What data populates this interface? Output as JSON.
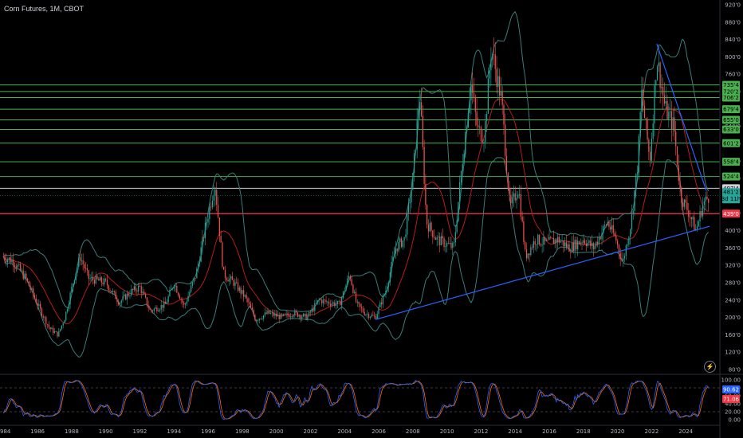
{
  "header": {
    "title": "Corn Futures, 1M, CBOT"
  },
  "icons": {
    "bolt": "lightning-icon"
  },
  "chart_data": {
    "type": "candlestick",
    "title": "Corn Futures, 1M, CBOT",
    "x_ticks": [
      "984",
      "1986",
      "1988",
      "1990",
      "1992",
      "1994",
      "1996",
      "1998",
      "2000",
      "2002",
      "2004",
      "2006",
      "2008",
      "2010",
      "2012",
      "2014",
      "2016",
      "2018",
      "2020",
      "2022",
      "2024"
    ],
    "price_ticks": [
      "920'0",
      "880'0",
      "840'0",
      "800'0",
      "760'0",
      "720'0",
      "680'0",
      "640'0",
      "600'0",
      "560'0",
      "520'0",
      "480'0",
      "440'0",
      "400'0",
      "360'0",
      "320'0",
      "280'0",
      "240'0",
      "200'0",
      "160'0",
      "120'0",
      "80'0"
    ],
    "ylim": [
      80,
      920
    ],
    "oscillator_ticks": [
      "100.00",
      "80.00",
      "60.00",
      "40.00",
      "20.00",
      "0.00"
    ],
    "oscillator_ylim": [
      0,
      100
    ],
    "oscillator_levels": [
      80,
      20
    ],
    "green_levels": [
      {
        "label": "735'4",
        "value": 735.5
      },
      {
        "label": "720'2",
        "value": 720.25
      },
      {
        "label": "706'2",
        "value": 706.25
      },
      {
        "label": "679'4",
        "value": 679.5
      },
      {
        "label": "655'0",
        "value": 655.0
      },
      {
        "label": "633'0",
        "value": 633.0
      },
      {
        "label": "601'2",
        "value": 601.25
      },
      {
        "label": "558'4",
        "value": 558.5
      },
      {
        "label": "524'4",
        "value": 524.5
      }
    ],
    "white_level": {
      "label": "497'4",
      "value": 497.5
    },
    "red_level": {
      "label": "439'0",
      "value": 439.0
    },
    "current_price": {
      "label": "481'2",
      "countdown": "3d 11h",
      "value": 481.25
    },
    "oscillator_values": {
      "k": "90.62",
      "d": "71.06"
    },
    "trendlines": [
      {
        "from": [
          2005.8,
          195
        ],
        "to": [
          2025.4,
          410
        ],
        "color": "#2962ff"
      },
      {
        "from": [
          2022.3,
          830
        ],
        "to": [
          2025.2,
          492
        ],
        "color": "#2962ff"
      }
    ],
    "colors": {
      "up": "#26a69a",
      "down": "#ef5350",
      "green_level": "#4caf50",
      "red_level": "#f23645",
      "bollinger": "#3a7d7a",
      "ma": "#b71c1c",
      "k_line": "#2962ff",
      "d_line": "#ff6d00"
    },
    "anchors": [
      [
        1984.0,
        340
      ],
      [
        1984.6,
        330
      ],
      [
        1985.3,
        290
      ],
      [
        1986.0,
        230
      ],
      [
        1986.7,
        175
      ],
      [
        1987.2,
        160
      ],
      [
        1987.6,
        200
      ],
      [
        1988.2,
        300
      ],
      [
        1988.5,
        340
      ],
      [
        1989.0,
        290
      ],
      [
        1990.0,
        280
      ],
      [
        1990.8,
        235
      ],
      [
        1991.5,
        260
      ],
      [
        1992.0,
        270
      ],
      [
        1992.6,
        215
      ],
      [
        1993.5,
        230
      ],
      [
        1994.0,
        280
      ],
      [
        1994.6,
        225
      ],
      [
        1995.3,
        300
      ],
      [
        1995.8,
        400
      ],
      [
        1996.4,
        510
      ],
      [
        1996.9,
        300
      ],
      [
        1997.5,
        280
      ],
      [
        1998.2,
        245
      ],
      [
        1998.8,
        195
      ],
      [
        1999.5,
        210
      ],
      [
        2000.3,
        200
      ],
      [
        2001.0,
        210
      ],
      [
        2001.8,
        200
      ],
      [
        2002.5,
        240
      ],
      [
        2003.0,
        235
      ],
      [
        2003.7,
        230
      ],
      [
        2004.3,
        300
      ],
      [
        2004.7,
        230
      ],
      [
        2005.2,
        210
      ],
      [
        2005.8,
        200
      ],
      [
        2006.4,
        260
      ],
      [
        2007.0,
        360
      ],
      [
        2007.5,
        380
      ],
      [
        2008.0,
        520
      ],
      [
        2008.4,
        720
      ],
      [
        2008.8,
        420
      ],
      [
        2009.4,
        380
      ],
      [
        2009.9,
        370
      ],
      [
        2010.4,
        360
      ],
      [
        2010.9,
        560
      ],
      [
        2011.4,
        740
      ],
      [
        2011.8,
        630
      ],
      [
        2012.2,
        620
      ],
      [
        2012.6,
        820
      ],
      [
        2013.2,
        700
      ],
      [
        2013.7,
        450
      ],
      [
        2014.2,
        500
      ],
      [
        2014.6,
        340
      ],
      [
        2015.2,
        380
      ],
      [
        2015.8,
        370
      ],
      [
        2016.5,
        380
      ],
      [
        2017.2,
        360
      ],
      [
        2018.0,
        380
      ],
      [
        2018.6,
        360
      ],
      [
        2019.4,
        420
      ],
      [
        2019.9,
        380
      ],
      [
        2020.3,
        325
      ],
      [
        2020.8,
        420
      ],
      [
        2021.2,
        560
      ],
      [
        2021.4,
        720
      ],
      [
        2021.9,
        560
      ],
      [
        2022.3,
        800
      ],
      [
        2022.8,
        680
      ],
      [
        2023.3,
        640
      ],
      [
        2023.7,
        480
      ],
      [
        2024.2,
        440
      ],
      [
        2024.6,
        400
      ],
      [
        2025.0,
        460
      ],
      [
        2025.4,
        481
      ]
    ]
  }
}
